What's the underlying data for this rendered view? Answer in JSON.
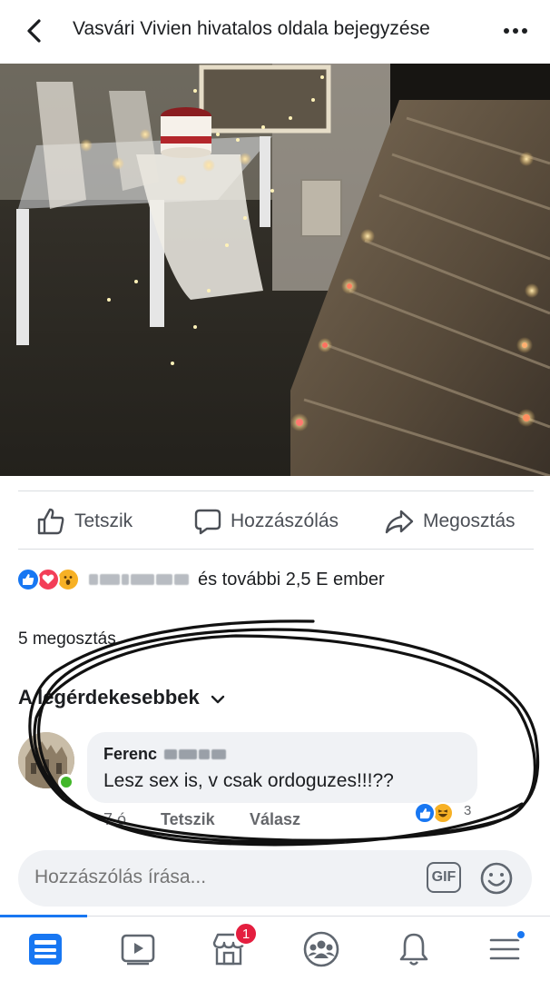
{
  "header": {
    "title": "Vasvári Vivien hivatalos oldala bejegyzése",
    "back_icon": "chevron-left-icon",
    "more_icon": "more-horizontal-icon"
  },
  "post": {
    "photo_description_icon": "photo"
  },
  "actions": {
    "like_label": "Tetszik",
    "comment_label": "Hozzászólás",
    "share_label": "Megosztás"
  },
  "reactions": {
    "summary": "és további 2,5 E ember",
    "types": [
      "like",
      "love",
      "wow"
    ]
  },
  "shares_label": "5 megosztás",
  "comment_filter": "A legérdekesebbek",
  "comment": {
    "author": "Ferenc",
    "text": "Lesz sex is, v csak ordoguzes!!!??",
    "time": "7 ó.",
    "like_label": "Tetszik",
    "reply_label": "Válasz",
    "reaction_count": "3"
  },
  "composer": {
    "placeholder": "Hozzászólás írása...",
    "gif_label": "GIF"
  },
  "nav": {
    "notification_badge": "1",
    "items": [
      "news-feed",
      "watch",
      "marketplace",
      "groups",
      "notifications",
      "menu"
    ]
  },
  "colors": {
    "accent": "#1877f2",
    "badge": "#e41e3f",
    "online": "#42b72a",
    "bubble": "#f0f2f5"
  }
}
